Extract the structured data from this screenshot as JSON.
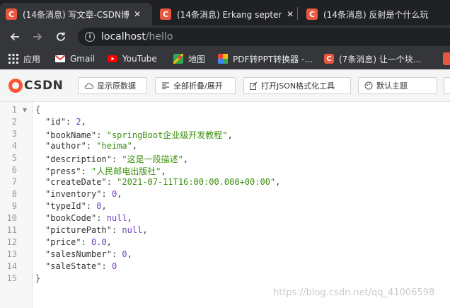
{
  "browser": {
    "tabs": [
      {
        "title": "(14条消息) 写文章-CSDN博",
        "favicon": "C",
        "active": true
      },
      {
        "title": "(14条消息) Erkang septem",
        "favicon": "C",
        "active": false
      },
      {
        "title": "(14条消息) 反射是个什么玩",
        "favicon": "C",
        "active": false
      }
    ],
    "close_glyph": "✕",
    "url_host": "localhost",
    "url_path": "/hello",
    "bookmarks": [
      {
        "label": "应用",
        "icon": "apps-icon"
      },
      {
        "label": "Gmail",
        "icon": "gmail-icon"
      },
      {
        "label": "YouTube",
        "icon": "youtube-icon"
      },
      {
        "label": "地图",
        "icon": "maps-icon"
      },
      {
        "label": "PDF转PPT转换器 -...",
        "icon": "pdf-converter-icon"
      },
      {
        "label": "(7条消息) 让一个块...",
        "icon": "csdn-icon"
      }
    ]
  },
  "json_viewer": {
    "logo_text": "CSDN",
    "buttons": [
      {
        "label": "显示原数据",
        "icon": "cloud-icon"
      },
      {
        "label": "全部折叠/展开",
        "icon": "collapse-icon"
      },
      {
        "label": "打开JSON格式化工具",
        "icon": "edit-icon"
      },
      {
        "label": "默认主题",
        "icon": "theme-icon"
      }
    ]
  },
  "json_lines": [
    {
      "no": "1",
      "indent": 0,
      "text": "{"
    },
    {
      "no": "2",
      "indent": 1,
      "key": "id",
      "value": "2",
      "vtype": "num",
      "comma": true
    },
    {
      "no": "3",
      "indent": 1,
      "key": "bookName",
      "value": "springBoot企业级开发教程",
      "vtype": "str",
      "comma": true
    },
    {
      "no": "4",
      "indent": 1,
      "key": "author",
      "value": "heima",
      "vtype": "str",
      "comma": true
    },
    {
      "no": "5",
      "indent": 1,
      "key": "description",
      "value": "这是一段描述",
      "vtype": "str",
      "comma": true
    },
    {
      "no": "6",
      "indent": 1,
      "key": "press",
      "value": "人民邮电出版社",
      "vtype": "str",
      "comma": true
    },
    {
      "no": "7",
      "indent": 1,
      "key": "createDate",
      "value": "2021-07-11T16:00:00.000+00:00",
      "vtype": "str",
      "comma": true
    },
    {
      "no": "8",
      "indent": 1,
      "key": "inventory",
      "value": "0",
      "vtype": "num",
      "comma": true
    },
    {
      "no": "9",
      "indent": 1,
      "key": "typeId",
      "value": "0",
      "vtype": "num",
      "comma": true
    },
    {
      "no": "10",
      "indent": 1,
      "key": "bookCode",
      "value": "null",
      "vtype": "null",
      "comma": true
    },
    {
      "no": "11",
      "indent": 1,
      "key": "picturePath",
      "value": "null",
      "vtype": "null",
      "comma": true
    },
    {
      "no": "12",
      "indent": 1,
      "key": "price",
      "value": "0.0",
      "vtype": "num",
      "comma": true
    },
    {
      "no": "13",
      "indent": 1,
      "key": "salesNumber",
      "value": "0",
      "vtype": "num",
      "comma": true
    },
    {
      "no": "14",
      "indent": 1,
      "key": "saleState",
      "value": "0",
      "vtype": "num",
      "comma": false
    },
    {
      "no": "15",
      "indent": 0,
      "text": "}"
    }
  ],
  "watermark": "https://blog.csdn.net/qq_41006598",
  "colors": {
    "tab_strip": "#202124",
    "toolbar": "#35363a",
    "csdn_red": "#fc5531",
    "json_string": "#3a8f0b",
    "json_number": "#6f42c1"
  }
}
